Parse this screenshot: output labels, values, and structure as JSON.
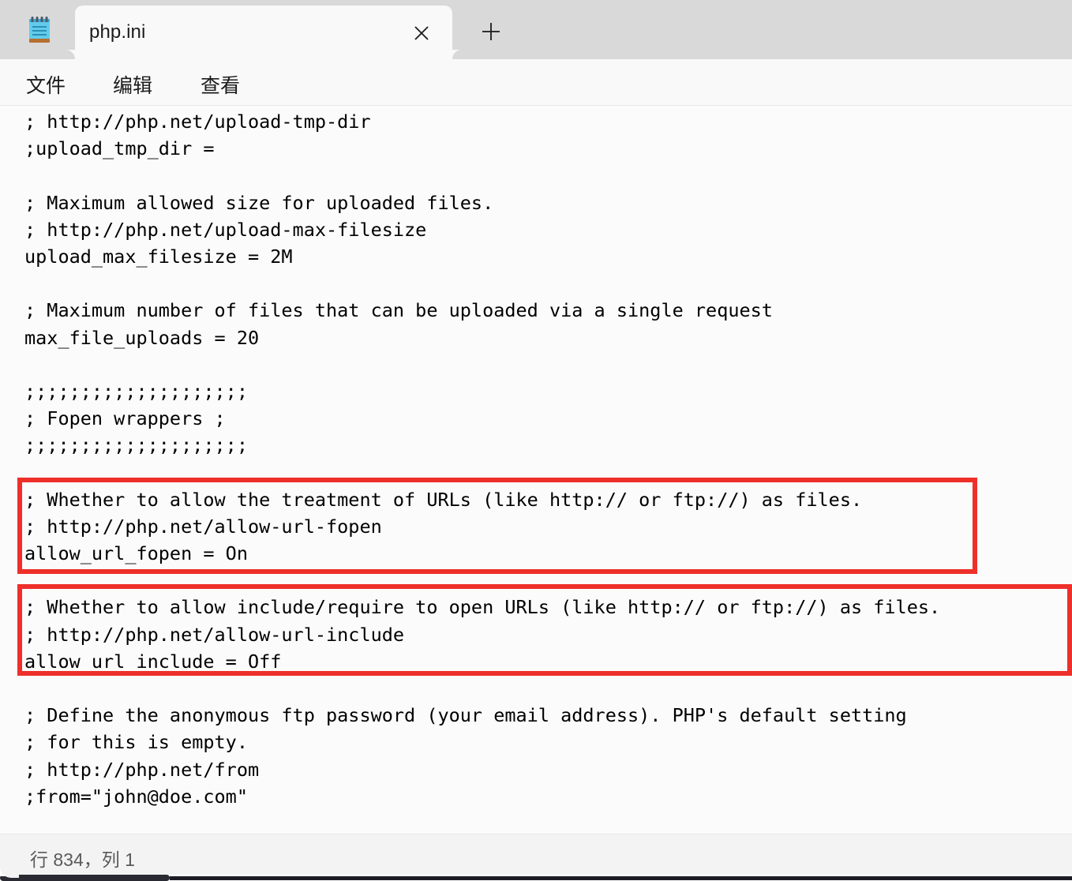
{
  "window": {
    "app_icon": "notepad-icon",
    "tab": {
      "title": "php.ini",
      "close_icon": "close-icon"
    },
    "new_tab_icon": "plus-icon"
  },
  "menu": {
    "items": [
      {
        "label": "文件",
        "name": "menu-file"
      },
      {
        "label": "编辑",
        "name": "menu-edit"
      },
      {
        "label": "查看",
        "name": "menu-view"
      }
    ]
  },
  "editor": {
    "lines": [
      "; http://php.net/upload-tmp-dir",
      ";upload_tmp_dir =",
      "",
      "; Maximum allowed size for uploaded files.",
      "; http://php.net/upload-max-filesize",
      "upload_max_filesize = 2M",
      "",
      "; Maximum number of files that can be uploaded via a single request",
      "max_file_uploads = 20",
      "",
      ";;;;;;;;;;;;;;;;;;;;",
      "; Fopen wrappers ;",
      ";;;;;;;;;;;;;;;;;;;;",
      "",
      "; Whether to allow the treatment of URLs (like http:// or ftp://) as files.",
      "; http://php.net/allow-url-fopen",
      "allow_url_fopen = On",
      "",
      "; Whether to allow include/require to open URLs (like http:// or ftp://) as files.",
      "; http://php.net/allow-url-include",
      "allow_url_include = Off",
      "",
      "; Define the anonymous ftp password (your email address). PHP's default setting",
      "; for this is empty.",
      "; http://php.net/from",
      ";from=\"john@doe.com\""
    ]
  },
  "annotations": {
    "highlight_color": "#ee2f2a",
    "boxes": [
      {
        "name": "highlight-allow-url-fopen",
        "target": "allow_url_fopen"
      },
      {
        "name": "highlight-allow-url-include",
        "target": "allow_url_include"
      }
    ]
  },
  "statusbar": {
    "position": "行 834，列 1"
  }
}
